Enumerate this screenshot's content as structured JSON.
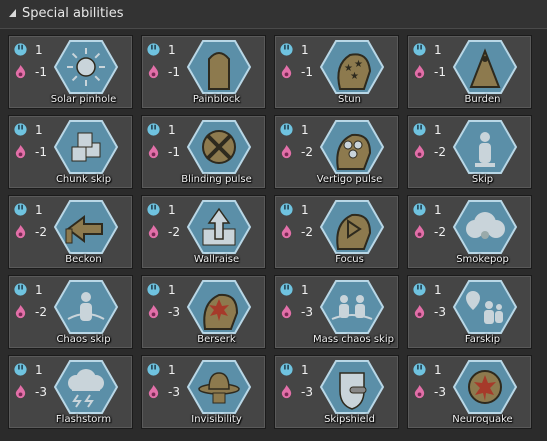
{
  "header": {
    "title": "Special abilities"
  },
  "colors": {
    "hex_fill": "#5b8fa8",
    "hex_border": "#b9d7e6",
    "cost_a": "#6fc3e0",
    "cost_b": "#e26fa8",
    "card_bg": "#454545"
  },
  "icons": {
    "cost_a_icon": "dial-icon",
    "cost_b_icon": "flame-icon"
  },
  "abilities": [
    {
      "name": "Solar pinhole",
      "cost_a": "1",
      "cost_b": "-1",
      "icon": "sun-icon"
    },
    {
      "name": "Painblock",
      "cost_a": "1",
      "cost_b": "-1",
      "icon": "head-icon"
    },
    {
      "name": "Stun",
      "cost_a": "1",
      "cost_b": "-1",
      "icon": "stars-head-icon"
    },
    {
      "name": "Burden",
      "cost_a": "1",
      "cost_b": "-1",
      "icon": "weight-icon"
    },
    {
      "name": "Chunk skip",
      "cost_a": "1",
      "cost_b": "-1",
      "icon": "blocks-icon"
    },
    {
      "name": "Blinding pulse",
      "cost_a": "1",
      "cost_b": "-1",
      "icon": "cross-eye-icon"
    },
    {
      "name": "Vertigo pulse",
      "cost_a": "1",
      "cost_b": "-2",
      "icon": "dots-head-icon"
    },
    {
      "name": "Skip",
      "cost_a": "1",
      "cost_b": "-2",
      "icon": "figure-icon"
    },
    {
      "name": "Beckon",
      "cost_a": "1",
      "cost_b": "-2",
      "icon": "arrow-left-icon"
    },
    {
      "name": "Wallraise",
      "cost_a": "1",
      "cost_b": "-2",
      "icon": "wall-arrow-icon"
    },
    {
      "name": "Focus",
      "cost_a": "1",
      "cost_b": "-2",
      "icon": "focus-head-icon"
    },
    {
      "name": "Smokepop",
      "cost_a": "1",
      "cost_b": "-2",
      "icon": "smoke-icon"
    },
    {
      "name": "Chaos skip",
      "cost_a": "1",
      "cost_b": "-2",
      "icon": "chaos-figure-icon"
    },
    {
      "name": "Berserk",
      "cost_a": "1",
      "cost_b": "-3",
      "icon": "burst-head-icon"
    },
    {
      "name": "Mass chaos skip",
      "cost_a": "1",
      "cost_b": "-3",
      "icon": "group-chaos-icon"
    },
    {
      "name": "Farskip",
      "cost_a": "1",
      "cost_b": "-3",
      "icon": "pin-figures-icon"
    },
    {
      "name": "Flashstorm",
      "cost_a": "1",
      "cost_b": "-3",
      "icon": "storm-cloud-icon"
    },
    {
      "name": "Invisibility",
      "cost_a": "1",
      "cost_b": "-3",
      "icon": "hat-icon"
    },
    {
      "name": "Skipshield",
      "cost_a": "1",
      "cost_b": "-3",
      "icon": "shield-icon"
    },
    {
      "name": "Neuroquake",
      "cost_a": "1",
      "cost_b": "-3",
      "icon": "quake-icon"
    }
  ]
}
